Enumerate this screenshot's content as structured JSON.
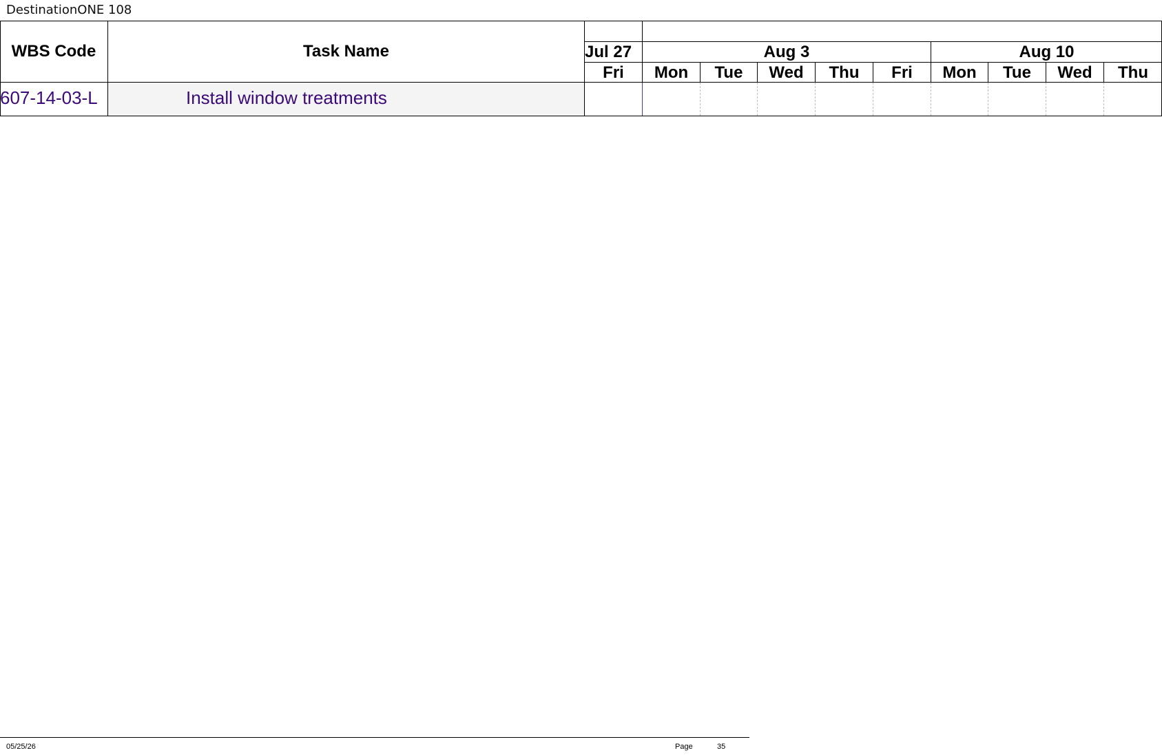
{
  "document": {
    "title": "DestinationONE 108"
  },
  "table": {
    "columns": {
      "wbs_code": "WBS Code",
      "task_name": "Task Name"
    },
    "timescale": {
      "weeks": [
        {
          "label": "Jul 27"
        },
        {
          "label": "Aug 3"
        },
        {
          "label": "Aug 10"
        }
      ],
      "days": [
        "Fri",
        "Mon",
        "Tue",
        "Wed",
        "Thu",
        "Fri",
        "Mon",
        "Tue",
        "Wed",
        "Thu"
      ]
    },
    "rows": [
      {
        "wbs": "607-14-03-L",
        "task": "Install window treatments"
      }
    ]
  },
  "footer": {
    "date": "05/25/26",
    "page_label": "Page",
    "page_number": "35"
  },
  "colors": {
    "task_text": "#3b0a78",
    "row_background": "#f4f4f4"
  }
}
